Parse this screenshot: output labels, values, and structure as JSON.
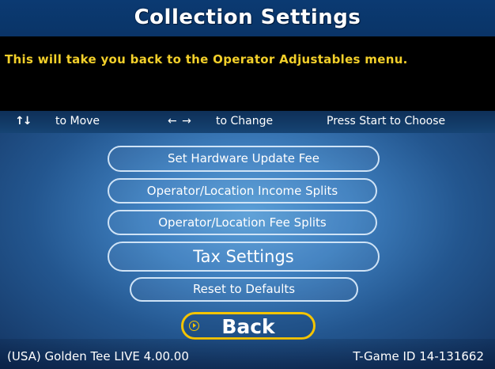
{
  "header": {
    "title": "Collection Settings"
  },
  "info": {
    "message": "This will take you back to the Operator Adjustables menu."
  },
  "hints": {
    "move_icon": "up-down-arrows-icon",
    "move_arrows": "↑↓",
    "move_label": "to Move",
    "change_icon": "left-right-arrows-icon",
    "change_arrows": "← →",
    "change_label": "to Change",
    "choose_label": "Press Start to Choose"
  },
  "menu": {
    "items": [
      {
        "label": "Set Hardware Update Fee"
      },
      {
        "label": "Operator/Location Income Splits"
      },
      {
        "label": "Operator/Location Fee Splits"
      },
      {
        "label": "Tax Settings"
      },
      {
        "label": "Reset to Defaults"
      }
    ],
    "back": {
      "label": "Back",
      "icon": "play-circle-icon",
      "selected": true
    }
  },
  "footer": {
    "version": "(USA) Golden Tee LIVE 4.00.00",
    "game_id": "T-Game ID 14-131662"
  },
  "colors": {
    "title_bar": "#0b3a72",
    "info_text": "#f2cf2a",
    "selection_outline": "#f4c400",
    "button_outline": "#cfe3f6",
    "background": "#3f80c0"
  }
}
